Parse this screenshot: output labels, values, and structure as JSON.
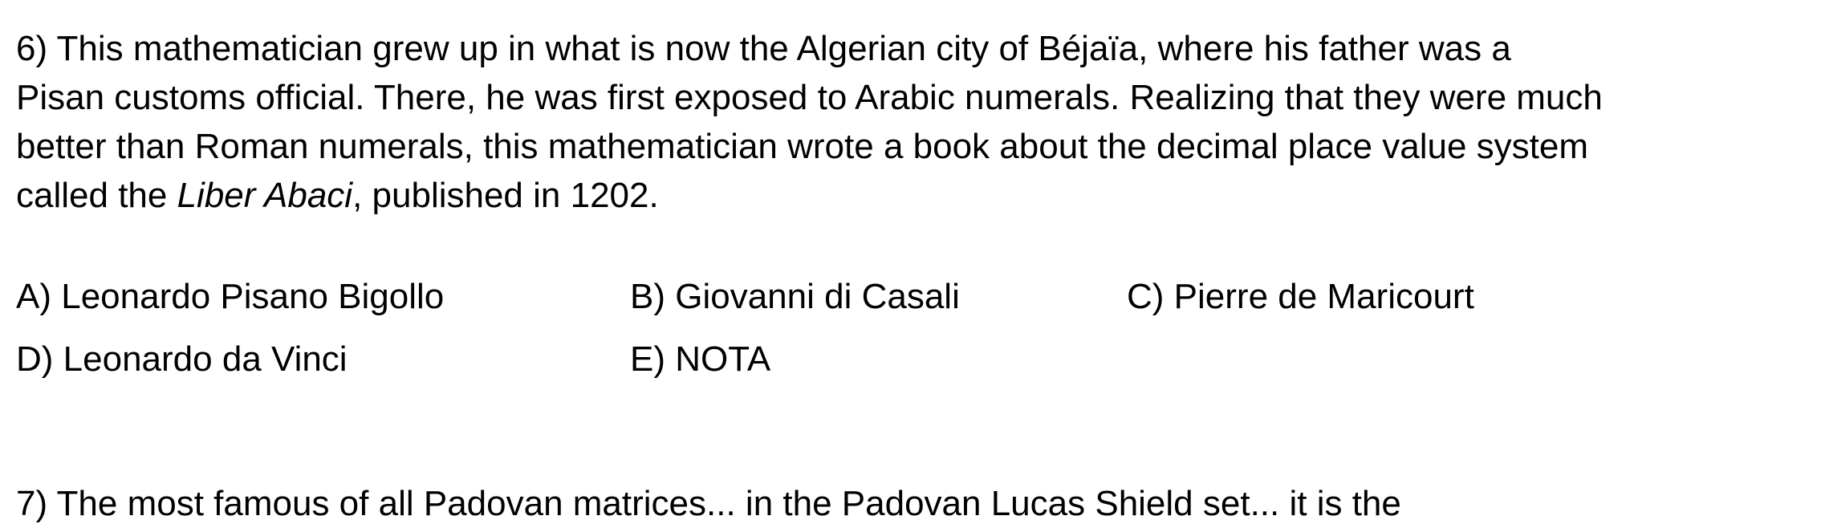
{
  "question": {
    "number": "6)",
    "text_before": " This mathematician grew up in what is now the Algerian city of Béjaïa, where his father was a Pisan customs official. There, he was first exposed to Arabic numerals. Realizing that they were much better than Roman numerals, this mathematician wrote a book about the decimal place value system called the ",
    "italic_title": "Liber Abaci",
    "text_after": ", published in 1202."
  },
  "choices": [
    {
      "label": "A)",
      "text": "Leonardo Pisano Bigollo"
    },
    {
      "label": "B)",
      "text": "Giovanni di Casali"
    },
    {
      "label": "C)",
      "text": "Pierre de Maricourt"
    },
    {
      "label": "D)",
      "text": "Leonardo da Vinci"
    },
    {
      "label": "E)",
      "text": "NOTA"
    }
  ],
  "next_question": {
    "text": "7) The most famous of all Padovan matrices... in the Padovan Lucas Shield set... it is the"
  }
}
